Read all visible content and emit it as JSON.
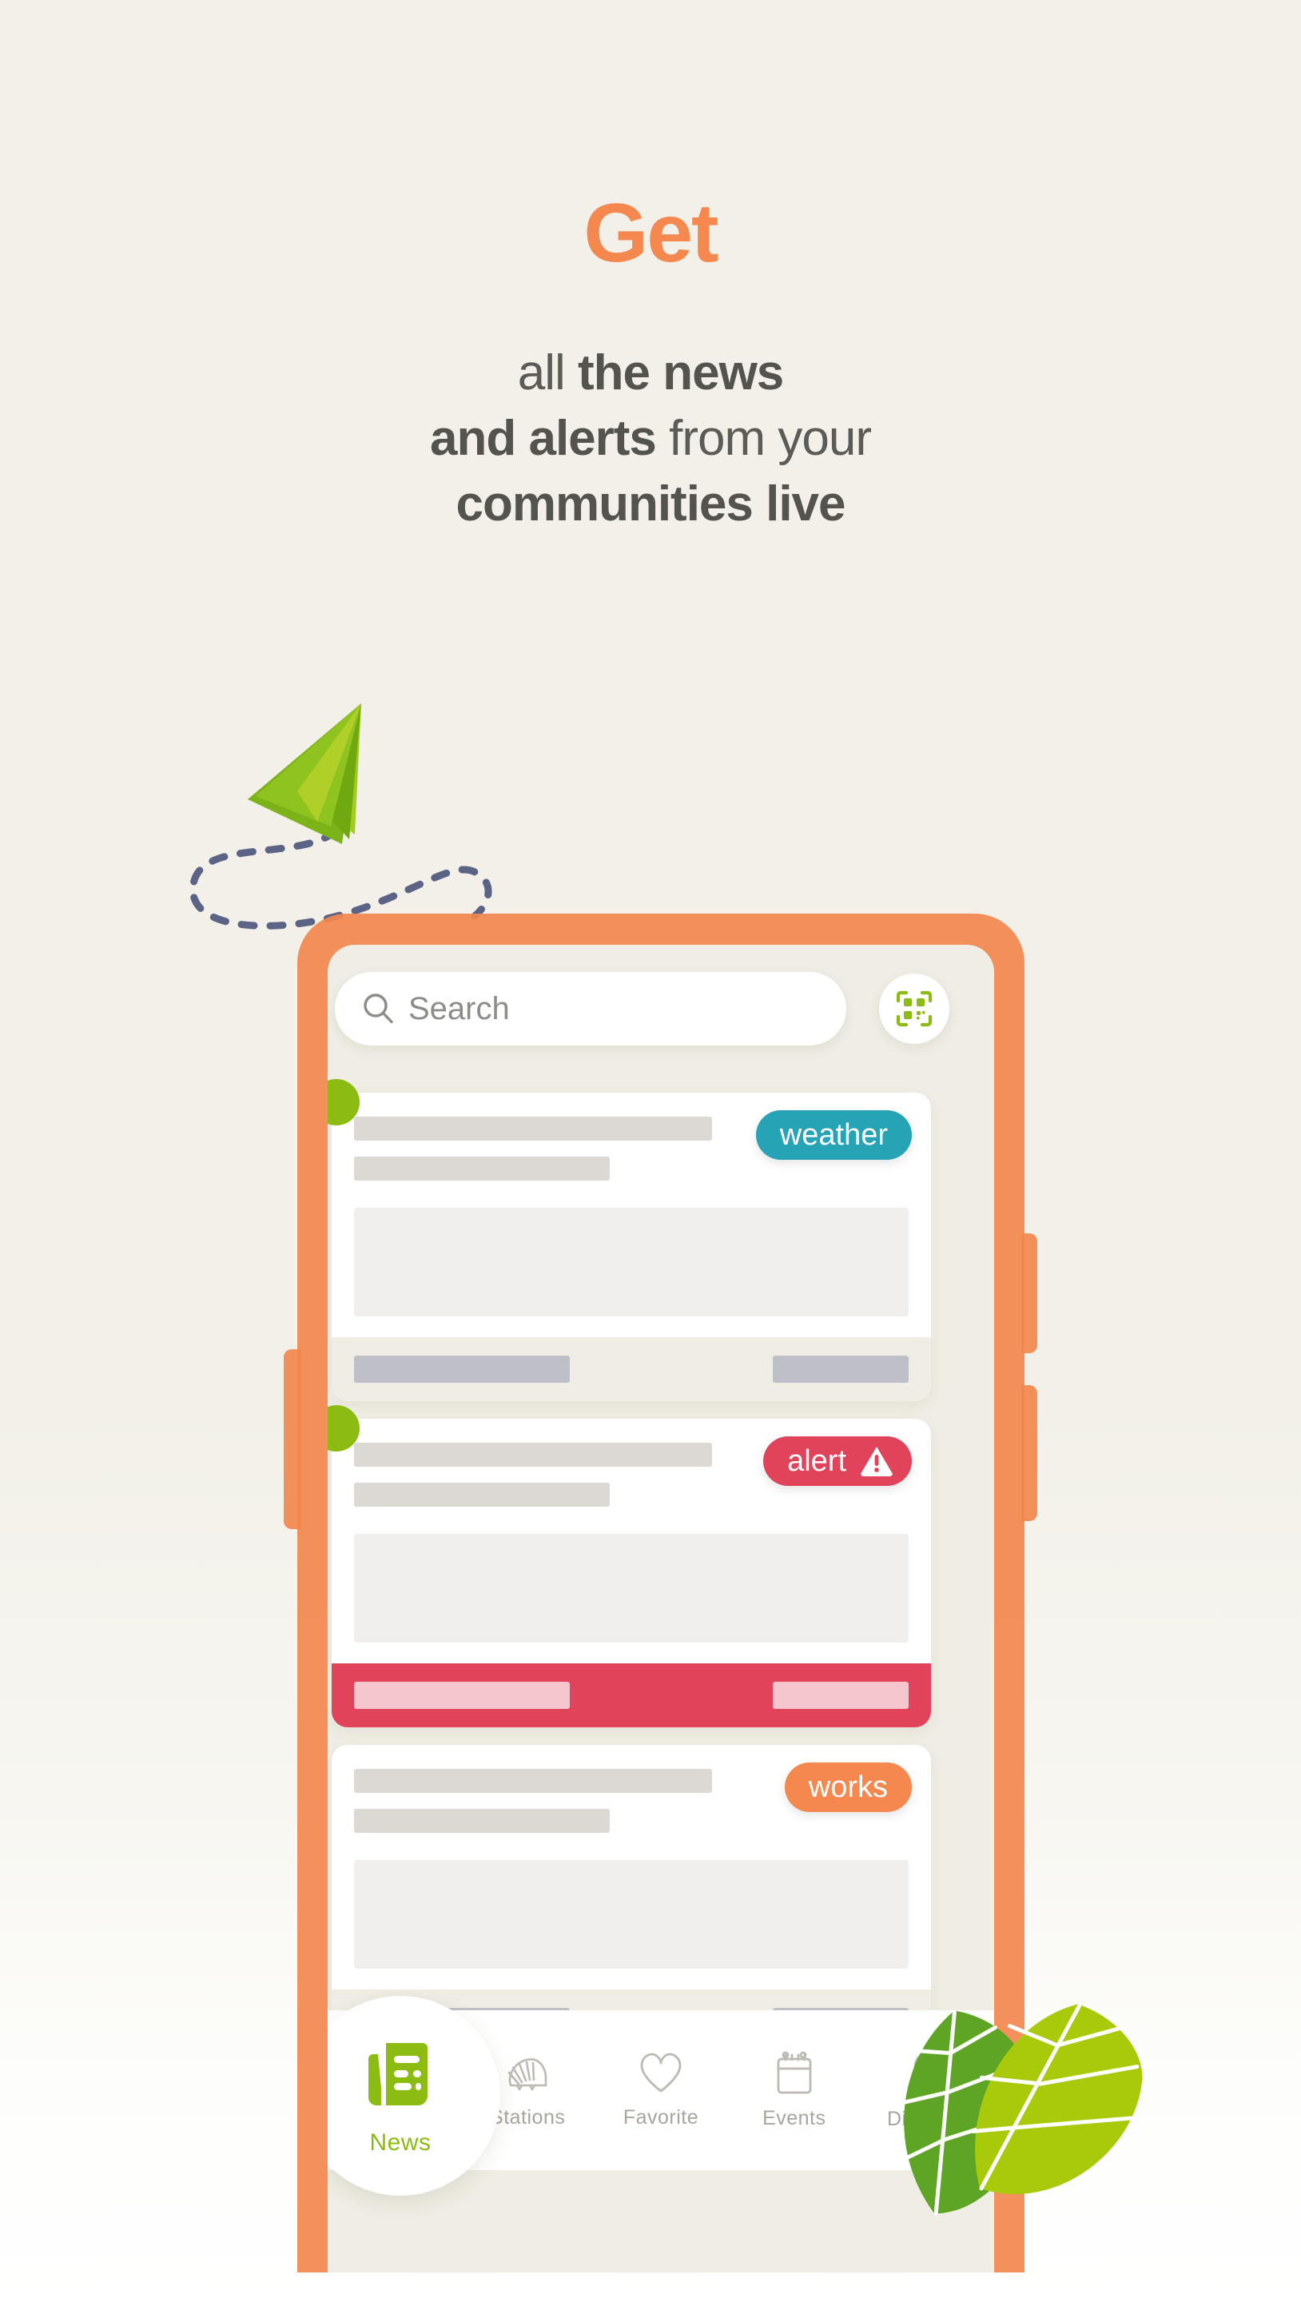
{
  "headline": {
    "accent_word": "Get",
    "accent_color": "#F5884F",
    "line1_regular": "all ",
    "line1_bold": "the news",
    "line2_bold": "and alerts",
    "line2_regular": " from your",
    "line3_bold": "communities live"
  },
  "colors": {
    "background": "#F2F0E8",
    "phone_frame": "#F2874E",
    "screen": "#EFEDE4",
    "green": "#8CBB12",
    "weather_badge": "#26A3B5",
    "alert_badge": "#E0435A",
    "works_badge": "#F5884F",
    "text_dark": "#5B5B57",
    "nav_inactive": "#A8A49E",
    "placeholder_line": "#DCD8D4",
    "footer_pill": "#BFC0C7"
  },
  "phone": {
    "search": {
      "placeholder": "Search",
      "icon": "search-icon"
    },
    "qr_button": {
      "icon": "qr-scan-icon"
    },
    "cards": [
      {
        "badge_label": "weather",
        "badge_type": "weather",
        "badge_icon": "",
        "has_unread_dot": true,
        "footer_style": "normal"
      },
      {
        "badge_label": "alert",
        "badge_type": "alert",
        "badge_icon": "warning-triangle-icon",
        "has_unread_dot": true,
        "footer_style": "danger"
      },
      {
        "badge_label": "works",
        "badge_type": "works",
        "badge_icon": "",
        "has_unread_dot": false,
        "footer_style": "normal"
      }
    ],
    "bottom_nav": [
      {
        "label": "News",
        "icon": "newspaper-icon",
        "active": true
      },
      {
        "label": "Stations",
        "icon": "hedgehog-icon",
        "active": false
      },
      {
        "label": "Favorite",
        "icon": "heart-icon",
        "active": false
      },
      {
        "label": "Events",
        "icon": "calendar-icon",
        "active": false
      },
      {
        "label": "Discover",
        "icon": "map-pin-icon",
        "active": false
      }
    ]
  },
  "decorations": {
    "paper_plane": "paper-plane-icon",
    "flight_trail": "dashed-loop-trail",
    "leaves": "two-leaves-icon"
  }
}
